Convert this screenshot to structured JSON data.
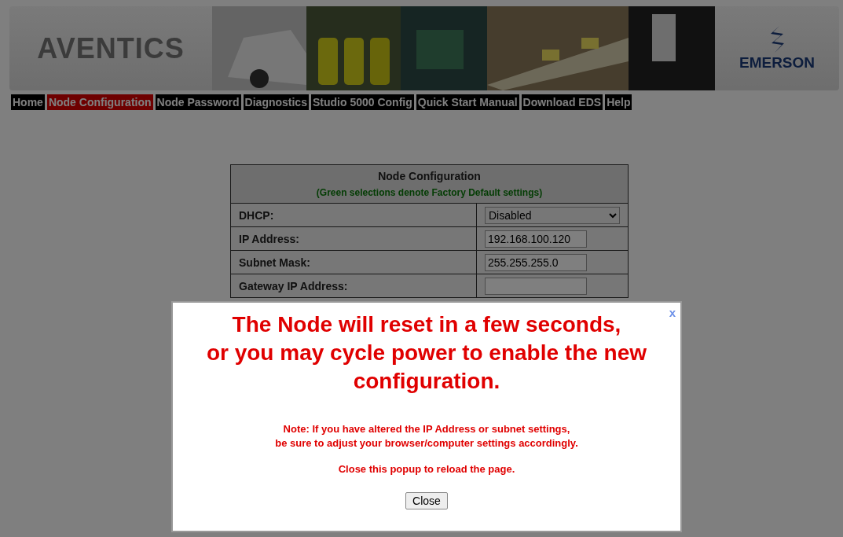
{
  "header": {
    "logo": "AVENTICS",
    "brand": "EMERSON"
  },
  "nav": [
    {
      "label": "Home",
      "selected": false
    },
    {
      "label": "Node Configuration",
      "selected": true
    },
    {
      "label": "Node Password",
      "selected": false
    },
    {
      "label": "Diagnostics",
      "selected": false
    },
    {
      "label": "Studio 5000 Config",
      "selected": false
    },
    {
      "label": "Quick Start Manual",
      "selected": false
    },
    {
      "label": "Download EDS",
      "selected": false
    },
    {
      "label": "Help",
      "selected": false
    }
  ],
  "config": {
    "title": "Node Configuration",
    "subtitle": "(Green selections denote Factory Default settings)",
    "rows": [
      {
        "label": "DHCP:",
        "kind": "select",
        "value": "Disabled"
      },
      {
        "label": "IP Address:",
        "kind": "input",
        "value": "192.168.100.120"
      },
      {
        "label": "Subnet Mask:",
        "kind": "input",
        "value": "255.255.255.0"
      },
      {
        "label": "Gateway IP Address:",
        "kind": "input"
      }
    ]
  },
  "popup": {
    "close_mark": "x",
    "headline": [
      "The Node will reset in a few seconds,",
      "or you may cycle power to enable the new configuration."
    ],
    "note": [
      "Note: If you have altered the IP Address or subnet settings,",
      "be sure to adjust your browser/computer settings accordingly."
    ],
    "reload": "Close this popup to reload the page.",
    "button": "Close"
  }
}
